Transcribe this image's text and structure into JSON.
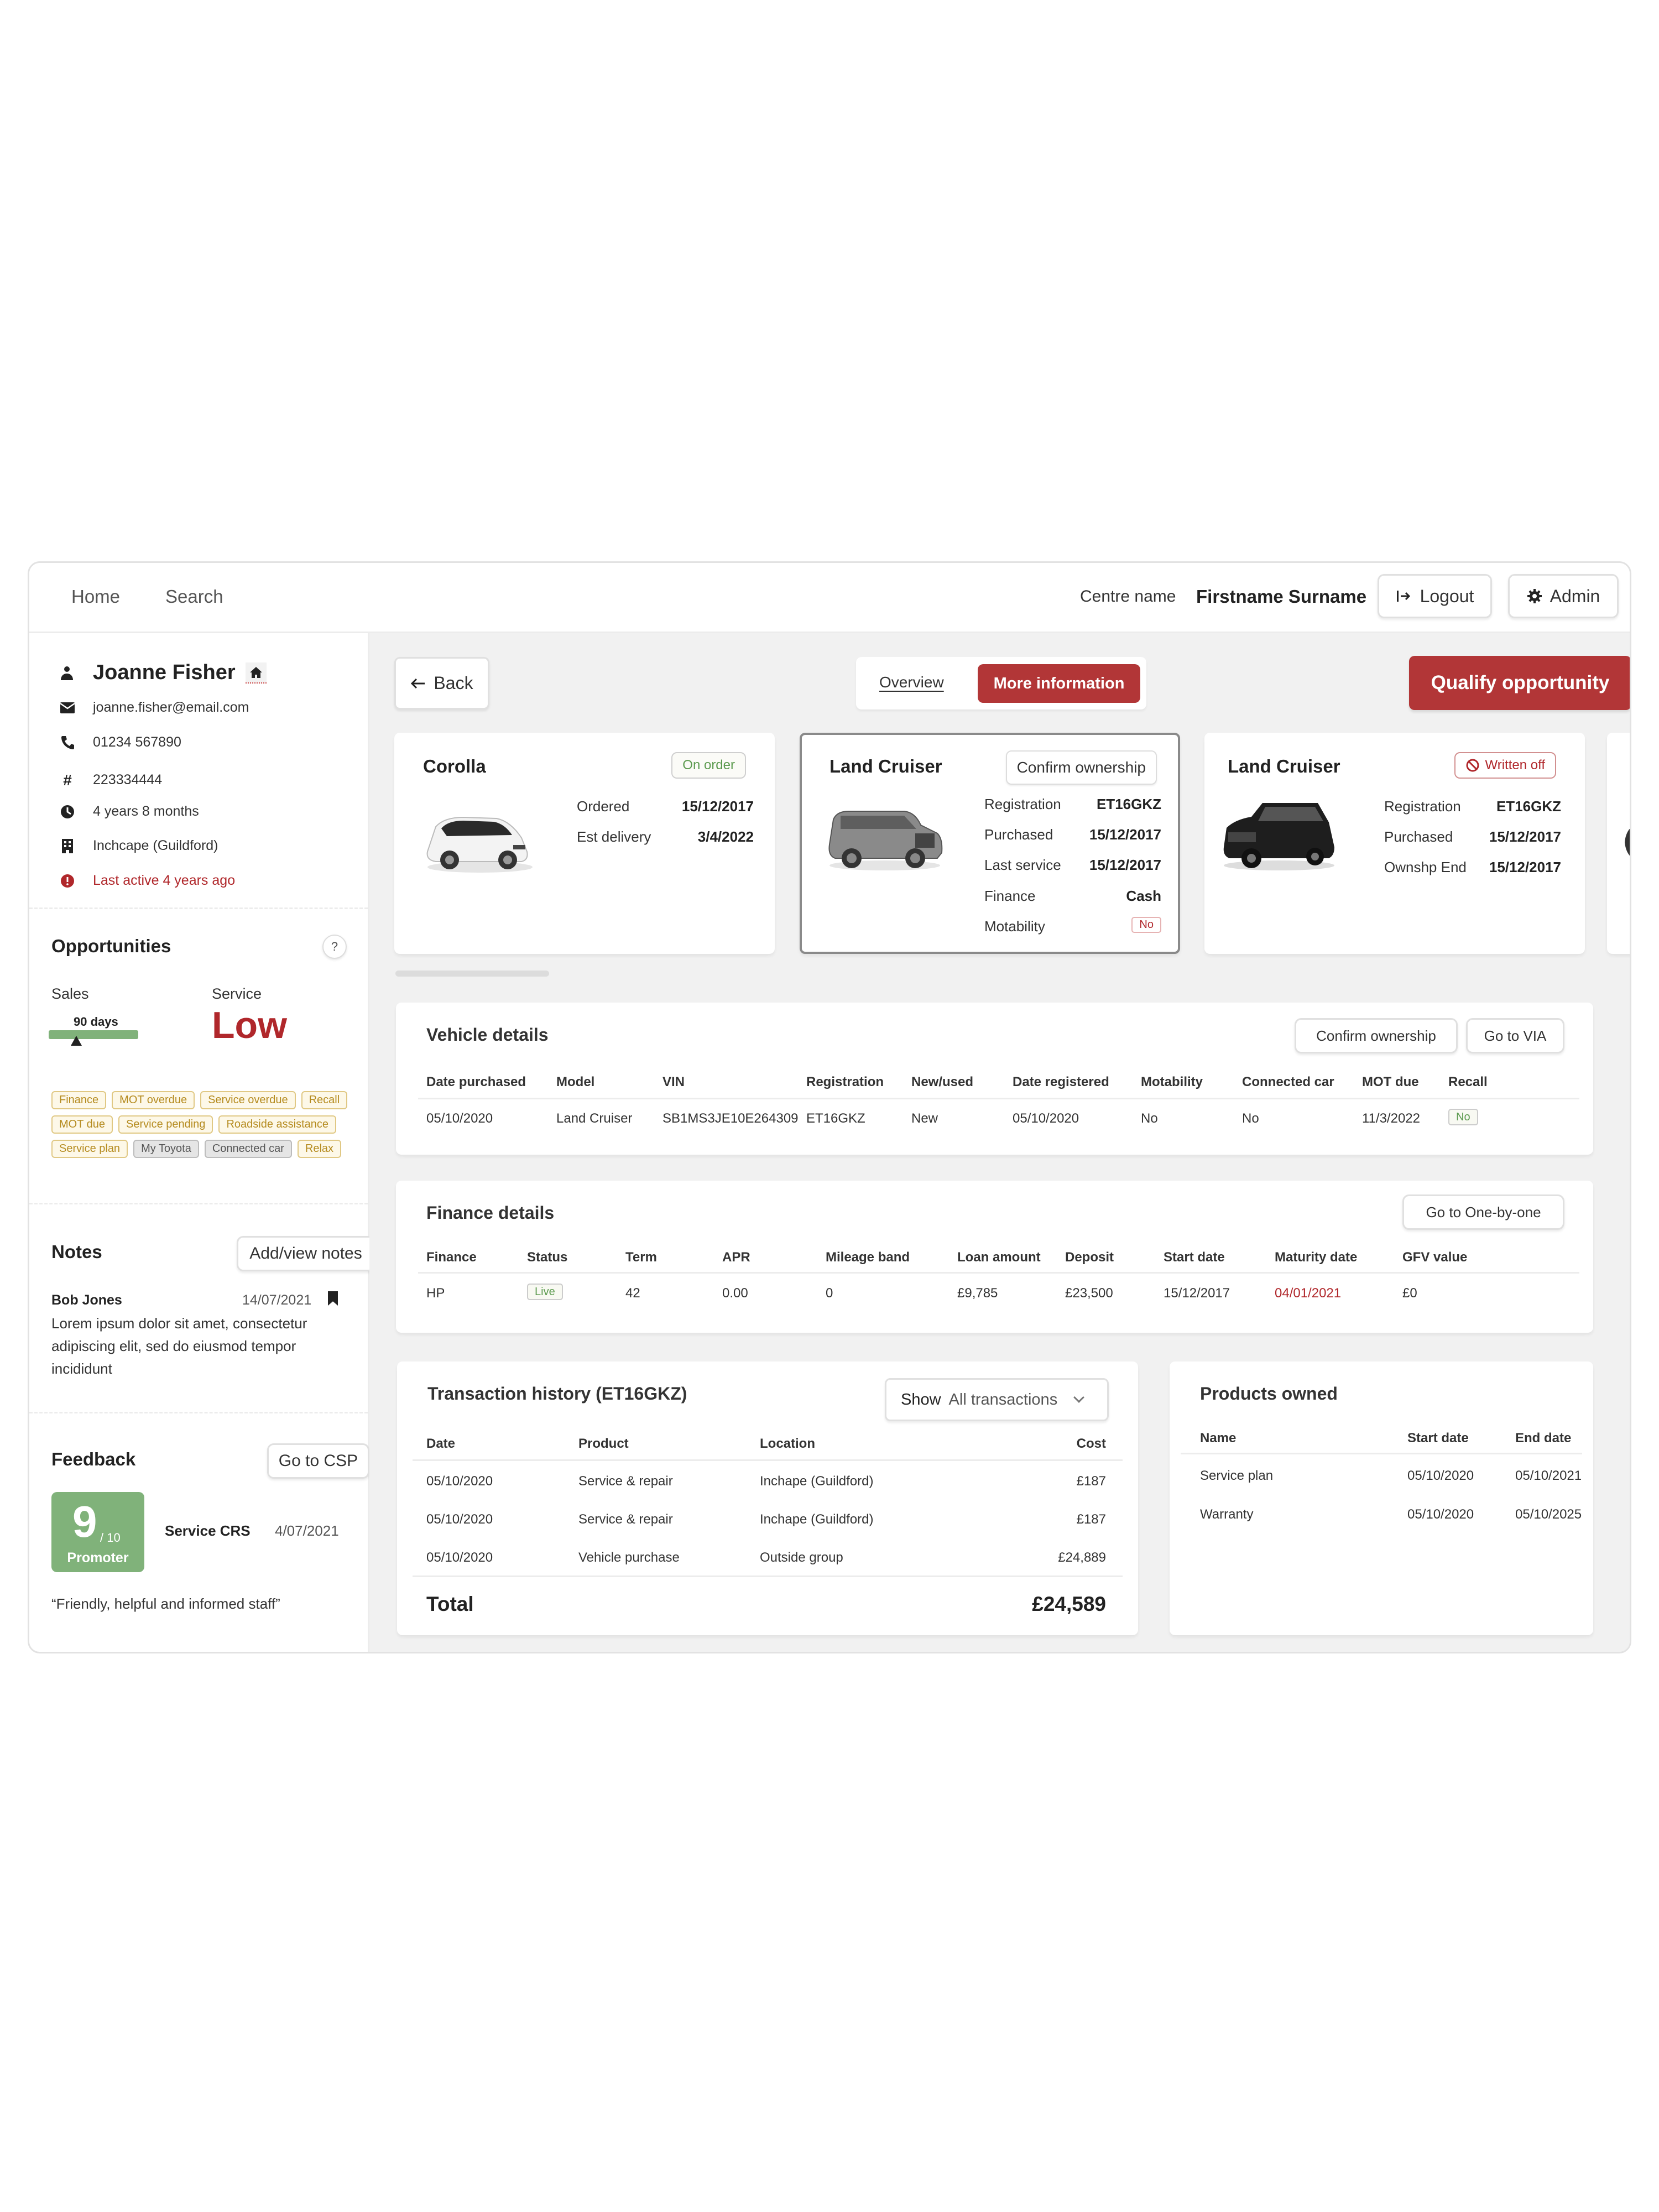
{
  "nav": {
    "home": "Home",
    "search": "Search",
    "centre_name": "Centre name",
    "user_name": "Firstname Surname",
    "logout": "Logout",
    "admin": "Admin"
  },
  "customer": {
    "name": "Joanne Fisher",
    "email": "joanne.fisher@email.com",
    "phone": "01234 567890",
    "id": "223334444",
    "tenure": "4 years 8 months",
    "dealer": "Inchcape (Guildford)",
    "last_active": "Last active 4 years ago"
  },
  "opportunities": {
    "title": "Opportunities",
    "help": "?",
    "sales_label": "Sales",
    "sales_days": "90 days",
    "sales_marker_fraction": 0.31,
    "service_label": "Service",
    "service_value": "Low",
    "tags": [
      {
        "label": "Finance",
        "style": "gold"
      },
      {
        "label": "MOT overdue",
        "style": "gold"
      },
      {
        "label": "Service overdue",
        "style": "gold"
      },
      {
        "label": "Recall",
        "style": "gold"
      },
      {
        "label": "MOT due",
        "style": "gold"
      },
      {
        "label": "Service pending",
        "style": "gold"
      },
      {
        "label": "Roadside assistance",
        "style": "gold"
      },
      {
        "label": "Service plan",
        "style": "gold"
      },
      {
        "label": "My Toyota",
        "style": "grey"
      },
      {
        "label": "Connected car",
        "style": "grey"
      },
      {
        "label": "Relax",
        "style": "gold"
      }
    ]
  },
  "notes": {
    "title": "Notes",
    "button": "Add/view notes",
    "author": "Bob Jones",
    "date": "14/07/2021",
    "body": "Lorem ipsum dolor sit amet, consectetur adipiscing elit, sed do eiusmod tempor incididunt"
  },
  "feedback": {
    "title": "Feedback",
    "button": "Go to CSP",
    "score": "9",
    "out_of": "/ 10",
    "category": "Promoter",
    "source": "Service CRS",
    "date": "4/07/2021",
    "quote": "“Friendly, helpful and informed staff”"
  },
  "toolbar": {
    "back": "Back",
    "tab_overview": "Overview",
    "tab_more": "More information",
    "qualify": "Qualify opportunity"
  },
  "vehicles": [
    {
      "model": "Corolla",
      "badge": "On order",
      "rows": [
        {
          "k": "Ordered",
          "v": "15/12/2017"
        },
        {
          "k": "Est delivery",
          "v": "3/4/2022"
        }
      ]
    },
    {
      "model": "Land Cruiser",
      "badge": "Confirm ownership",
      "rows": [
        {
          "k": "Registration",
          "v": "ET16GKZ"
        },
        {
          "k": "Purchased",
          "v": "15/12/2017"
        },
        {
          "k": "Last service",
          "v": "15/12/2017"
        },
        {
          "k": "Finance",
          "v": "Cash"
        },
        {
          "k": "Motability",
          "v": "No"
        }
      ]
    },
    {
      "model": "Land Cruiser",
      "badge": "Written off",
      "rows": [
        {
          "k": "Registration",
          "v": "ET16GKZ"
        },
        {
          "k": "Purchased",
          "v": "15/12/2017"
        },
        {
          "k": "Ownshp End",
          "v": "15/12/2017"
        }
      ]
    }
  ],
  "vehicle_details": {
    "title": "Vehicle details",
    "btn_confirm": "Confirm ownership",
    "btn_via": "Go to VIA",
    "headers": [
      "Date purchased",
      "Model",
      "VIN",
      "Registration",
      "New/used",
      "Date registered",
      "Motability",
      "Connected car",
      "MOT due",
      "Recall"
    ],
    "row": [
      "05/10/2020",
      "Land Cruiser",
      "SB1MS3JE10E264309",
      "ET16GKZ",
      "New",
      "05/10/2020",
      "No",
      "No",
      "11/3/2022",
      "No"
    ]
  },
  "finance_details": {
    "title": "Finance details",
    "btn": "Go to One-by-one",
    "headers": [
      "Finance",
      "Status",
      "Term",
      "APR",
      "Mileage band",
      "Loan amount",
      "Deposit",
      "Start date",
      "Maturity date",
      "GFV value"
    ],
    "row": [
      "HP",
      "Live",
      "42",
      "0.00",
      "0",
      "£9,785",
      "£23,500",
      "15/12/2017",
      "04/01/2021",
      "£0"
    ]
  },
  "transactions": {
    "title": "Transaction history  (ET16GKZ)",
    "show_label": "Show",
    "show_value": "All transactions",
    "headers": [
      "Date",
      "Product",
      "Location",
      "Cost"
    ],
    "rows": [
      [
        "05/10/2020",
        "Service & repair",
        "Inchape (Guildford)",
        "£187"
      ],
      [
        "05/10/2020",
        "Service & repair",
        "Inchape (Guildford)",
        "£187"
      ],
      [
        "05/10/2020",
        "Vehicle purchase",
        "Outside group",
        "£24,889"
      ]
    ],
    "total_label": "Total",
    "total_value": "£24,589"
  },
  "products": {
    "title": "Products owned",
    "headers": [
      "Name",
      "Start date",
      "End date"
    ],
    "rows": [
      [
        "Service plan",
        "05/10/2020",
        "05/10/2021"
      ],
      [
        "Warranty",
        "05/10/2020",
        "05/10/2025"
      ]
    ]
  },
  "colors": {
    "brand_red": "#b23637",
    "alert_red": "#b0272b",
    "promoter_green": "#80b27a",
    "tag_gold": "#b58b1f"
  }
}
